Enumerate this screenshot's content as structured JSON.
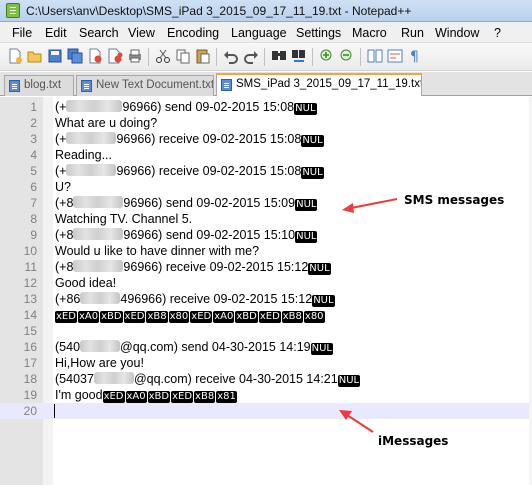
{
  "window": {
    "title": "C:\\Users\\anv\\Desktop\\SMS_iPad 3_2015_09_17_11_19.txt - Notepad++"
  },
  "menu": [
    "File",
    "Edit",
    "Search",
    "View",
    "Encoding",
    "Language",
    "Settings",
    "Macro",
    "Run",
    "Window",
    "?"
  ],
  "toolbar_icons": [
    "new-file-icon",
    "open-file-icon",
    "save-icon",
    "save-all-icon",
    "close-icon",
    "close-all-icon",
    "print-icon",
    "cut-icon",
    "copy-icon",
    "paste-icon",
    "undo-icon",
    "redo-icon",
    "find-icon",
    "replace-icon",
    "zoom-in-icon",
    "zoom-out-icon",
    "sync-scroll-icon",
    "wrap-icon",
    "show-all-chars-icon"
  ],
  "tabs": [
    {
      "label": "blog.txt",
      "active": false
    },
    {
      "label": "New Text Document.txt",
      "active": false
    },
    {
      "label": "SMS_iPad 3_2015_09_17_11_19.txt",
      "active": true
    }
  ],
  "lines": [
    {
      "n": "1",
      "parts": [
        {
          "t": "text",
          "v": "(+"
        },
        {
          "t": "blur",
          "w": 56
        },
        {
          "t": "text",
          "v": "96966) send 09-02-2015 15:08"
        },
        {
          "t": "ctrl",
          "v": "NUL"
        }
      ]
    },
    {
      "n": "2",
      "parts": [
        {
          "t": "text",
          "v": "What are u doing?"
        }
      ]
    },
    {
      "n": "3",
      "parts": [
        {
          "t": "text",
          "v": "(+"
        },
        {
          "t": "blur",
          "w": 50
        },
        {
          "t": "text",
          "v": "96966) receive 09-02-2015 15:08"
        },
        {
          "t": "ctrl",
          "v": "NUL"
        }
      ]
    },
    {
      "n": "4",
      "parts": [
        {
          "t": "text",
          "v": "Reading..."
        }
      ]
    },
    {
      "n": "5",
      "parts": [
        {
          "t": "text",
          "v": "(+"
        },
        {
          "t": "blur",
          "w": 50
        },
        {
          "t": "text",
          "v": "96966) receive 09-02-2015 15:08"
        },
        {
          "t": "ctrl",
          "v": "NUL"
        }
      ]
    },
    {
      "n": "6",
      "parts": [
        {
          "t": "text",
          "v": "U?"
        }
      ]
    },
    {
      "n": "7",
      "parts": [
        {
          "t": "text",
          "v": "(+8"
        },
        {
          "t": "blur",
          "w": 50
        },
        {
          "t": "text",
          "v": "96966) send 09-02-2015 15:09"
        },
        {
          "t": "ctrl",
          "v": "NUL"
        }
      ]
    },
    {
      "n": "8",
      "parts": [
        {
          "t": "text",
          "v": "Watching TV. Channel 5."
        }
      ]
    },
    {
      "n": "9",
      "parts": [
        {
          "t": "text",
          "v": "(+8"
        },
        {
          "t": "blur",
          "w": 50
        },
        {
          "t": "text",
          "v": "96966) send 09-02-2015 15:10"
        },
        {
          "t": "ctrl",
          "v": "NUL"
        }
      ]
    },
    {
      "n": "10",
      "parts": [
        {
          "t": "text",
          "v": "Would u like to have dinner with me?"
        }
      ]
    },
    {
      "n": "11",
      "parts": [
        {
          "t": "text",
          "v": "(+8"
        },
        {
          "t": "blur",
          "w": 50
        },
        {
          "t": "text",
          "v": "96966) receive 09-02-2015 15:12"
        },
        {
          "t": "ctrl",
          "v": "NUL"
        }
      ]
    },
    {
      "n": "12",
      "parts": [
        {
          "t": "text",
          "v": "Good idea!"
        }
      ]
    },
    {
      "n": "13",
      "parts": [
        {
          "t": "text",
          "v": "(+86"
        },
        {
          "t": "blur",
          "w": 40
        },
        {
          "t": "text",
          "v": "496966) receive 09-02-2015 15:12"
        },
        {
          "t": "ctrl",
          "v": "NUL"
        }
      ]
    },
    {
      "n": "14",
      "parts": [
        {
          "t": "ctrl",
          "v": "xED"
        },
        {
          "t": "ctrl",
          "v": "xA0"
        },
        {
          "t": "ctrl",
          "v": "xBD"
        },
        {
          "t": "ctrl",
          "v": "xED"
        },
        {
          "t": "ctrl",
          "v": "xB8"
        },
        {
          "t": "ctrl",
          "v": "x80"
        },
        {
          "t": "ctrl",
          "v": "xED"
        },
        {
          "t": "ctrl",
          "v": "xA0"
        },
        {
          "t": "ctrl",
          "v": "xBD"
        },
        {
          "t": "ctrl",
          "v": "xED"
        },
        {
          "t": "ctrl",
          "v": "xB8"
        },
        {
          "t": "ctrl",
          "v": "x80"
        }
      ]
    },
    {
      "n": "15",
      "parts": []
    },
    {
      "n": "16",
      "parts": [
        {
          "t": "text",
          "v": "(540"
        },
        {
          "t": "blur",
          "w": 40
        },
        {
          "t": "text",
          "v": "@qq.com) send 04-30-2015 14:19"
        },
        {
          "t": "ctrl",
          "v": "NUL"
        }
      ]
    },
    {
      "n": "17",
      "parts": [
        {
          "t": "text",
          "v": "Hi,How are you!"
        }
      ]
    },
    {
      "n": "18",
      "parts": [
        {
          "t": "text",
          "v": "(54037"
        },
        {
          "t": "blur",
          "w": 40
        },
        {
          "t": "text",
          "v": "@qq.com) receive 04-30-2015 14:21"
        },
        {
          "t": "ctrl",
          "v": "NUL"
        }
      ]
    },
    {
      "n": "19",
      "parts": [
        {
          "t": "text",
          "v": " I'm good"
        },
        {
          "t": "ctrl",
          "v": "xED"
        },
        {
          "t": "ctrl",
          "v": "xA0"
        },
        {
          "t": "ctrl",
          "v": "xBD"
        },
        {
          "t": "ctrl",
          "v": "xED"
        },
        {
          "t": "ctrl",
          "v": "xB8"
        },
        {
          "t": "ctrl",
          "v": "x81"
        }
      ]
    },
    {
      "n": "20",
      "parts": [],
      "current": true
    }
  ],
  "annotations": {
    "sms": "SMS messages",
    "imessages": "iMessages"
  },
  "colors": {
    "arrow": "#ee3b3b",
    "active_tab_accent": "#f2a541",
    "current_line": "#e8e8ff"
  }
}
